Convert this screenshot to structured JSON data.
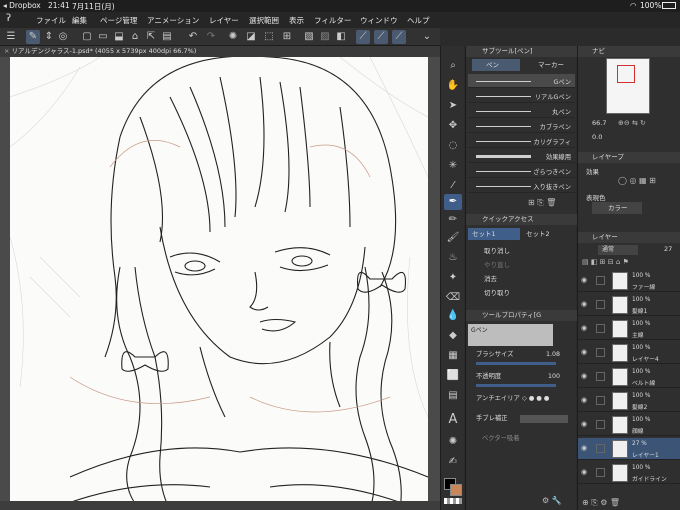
{
  "status": {
    "carrier": "◂ Dropbox",
    "time": "21:41",
    "date": "7月11日(月)",
    "battery": "100%"
  },
  "menu": [
    "ファイル",
    "編集",
    "ページ管理",
    "アニメーション",
    "レイヤー",
    "選択範囲",
    "表示",
    "フィルター",
    "ウィンドウ",
    "ヘルプ"
  ],
  "document": {
    "tab_title": "リアルデンジャラス-1.psd* (4055 x 5739px 400dpi 66.7%)"
  },
  "subtool_panel": {
    "header": "サブツール[ペン]",
    "tabs": [
      "ペン",
      "マーカー"
    ],
    "brushes": [
      "Gペン",
      "リアルGペン",
      "丸ペン",
      "カブラペン",
      "カリグラフィ",
      "効果線用",
      "ざらつきペン",
      "入り抜きペン"
    ]
  },
  "quick_access": {
    "header": "クイックアクセス",
    "tabs": [
      "セット1",
      "セット2"
    ],
    "items": [
      "取り消し",
      "やり直し",
      "消去",
      "切り取り"
    ]
  },
  "tool_property": {
    "header": "ツールプロパティ[G",
    "brush_name": "Gペン",
    "brush_size_label": "ブラシサイズ",
    "brush_size_value": "1.08",
    "opacity_label": "不透明度",
    "opacity_value": "100",
    "antialias_label": "アンチエイリア",
    "stabilization_label": "手ブレ補正",
    "vector_label": "ベクター吸着"
  },
  "navigator": {
    "tab": "ナビ",
    "zoom": "66.7",
    "rotation": "0.0"
  },
  "layer_property": {
    "header": "レイヤープ",
    "effect_label": "効果",
    "color_label": "表現色",
    "color_value": "カラー"
  },
  "layers_panel": {
    "header": "レイヤー",
    "blend_mode": "通常",
    "opacity": "27",
    "layers": [
      {
        "pct": "100 %",
        "mode": "通",
        "name": "ファー線"
      },
      {
        "pct": "100 %",
        "mode": "通",
        "name": "髪線1"
      },
      {
        "pct": "100 %",
        "mode": "通",
        "name": "主線"
      },
      {
        "pct": "100 %",
        "mode": "通",
        "name": "レイヤー4"
      },
      {
        "pct": "100 %",
        "mode": "通",
        "name": "ベルト線"
      },
      {
        "pct": "100 %",
        "mode": "通",
        "name": "髪線2"
      },
      {
        "pct": "100 %",
        "mode": "通",
        "name": "顔線"
      },
      {
        "pct": "27 %",
        "mode": "通常",
        "name": "レイヤー1"
      },
      {
        "pct": "100 %",
        "mode": "通",
        "name": "ガイドライン"
      }
    ],
    "selected_index": 7
  },
  "colors": {
    "accent": "#3f5e8a",
    "main_color": "#000000",
    "sub_color": "#c8865a"
  }
}
